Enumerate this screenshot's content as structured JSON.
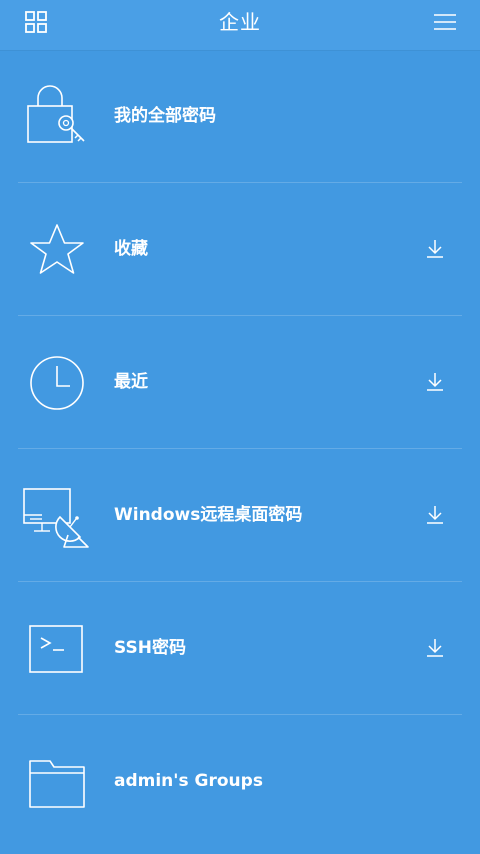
{
  "header": {
    "title": "企业"
  },
  "list": {
    "items": [
      {
        "label": "我的全部密码",
        "icon": "lock-key-icon",
        "downloadable": false
      },
      {
        "label": "收藏",
        "icon": "star-icon",
        "downloadable": true
      },
      {
        "label": "最近",
        "icon": "clock-icon",
        "downloadable": true
      },
      {
        "label": "Windows远程桌面密码",
        "icon": "remote-desktop-icon",
        "downloadable": true
      },
      {
        "label": "SSH密码",
        "icon": "terminal-icon",
        "downloadable": true
      },
      {
        "label": "admin's Groups",
        "icon": "folder-icon",
        "downloadable": false
      }
    ]
  },
  "colors": {
    "background": "#4299e1",
    "header": "#4a9fe6",
    "foreground": "#ffffff"
  }
}
